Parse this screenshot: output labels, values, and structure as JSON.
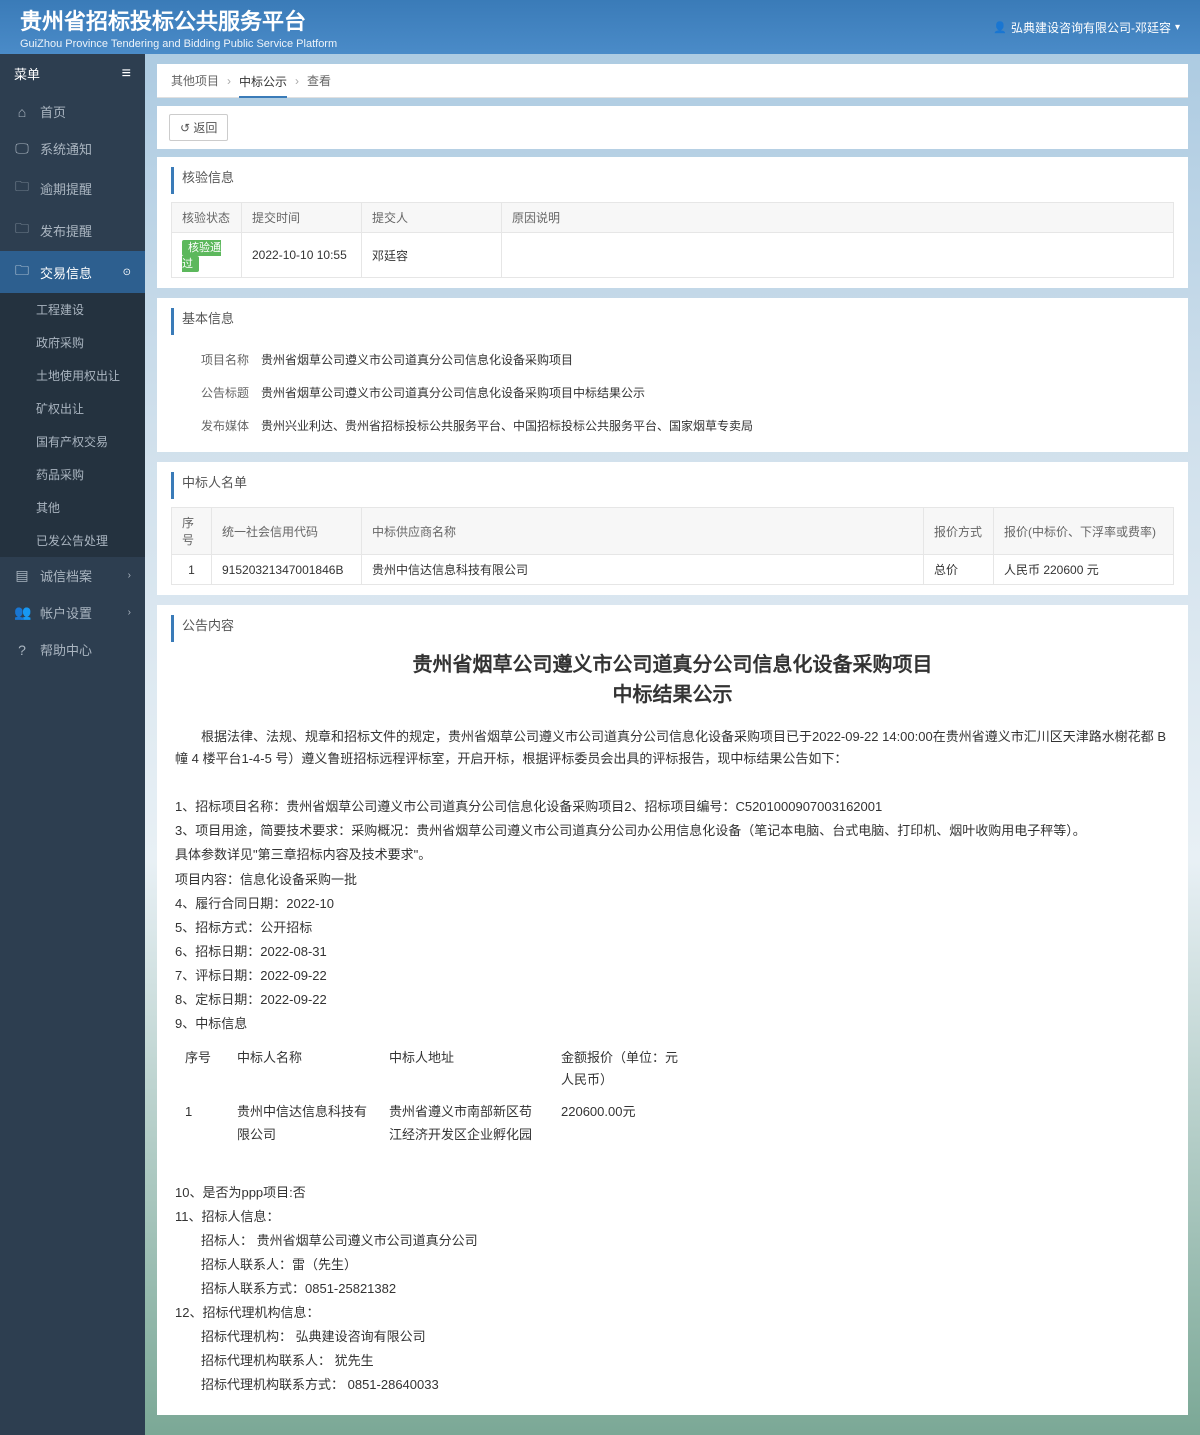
{
  "header": {
    "title": "贵州省招标投标公共服务平台",
    "subtitle": "GuiZhou Province Tendering and Bidding Public Service Platform",
    "user": "弘典建设咨询有限公司-邓廷容"
  },
  "sidebar": {
    "menu_label": "菜单",
    "items": [
      {
        "icon": "⌂",
        "label": "首页"
      },
      {
        "icon": "🖵",
        "label": "系统通知"
      },
      {
        "icon": "🗀",
        "label": "逾期提醒"
      },
      {
        "icon": "🗀",
        "label": "发布提醒"
      },
      {
        "icon": "🗀",
        "label": "交易信息",
        "active": true,
        "expanded": true
      },
      {
        "icon": "▤",
        "label": "诚信档案",
        "chevron": true
      },
      {
        "icon": "👥",
        "label": "帐户设置",
        "chevron": true
      },
      {
        "icon": "?",
        "label": "帮助中心"
      }
    ],
    "sub_items": [
      "工程建设",
      "政府采购",
      "土地使用权出让",
      "矿权出让",
      "国有产权交易",
      "药品采购",
      "其他",
      "已发公告处理"
    ]
  },
  "breadcrumb": {
    "a": "其他项目",
    "b": "中标公示",
    "c": "查看"
  },
  "back_label": "返回",
  "panels": {
    "verify": {
      "title": "核验信息",
      "headers": [
        "核验状态",
        "提交时间",
        "提交人",
        "原因说明"
      ],
      "row": {
        "status": "核验通过",
        "time": "2022-10-10 10:55",
        "person": "邓廷容",
        "reason": ""
      }
    },
    "basic": {
      "title": "基本信息",
      "rows": [
        {
          "label": "项目名称",
          "value": "贵州省烟草公司遵义市公司道真分公司信息化设备采购项目"
        },
        {
          "label": "公告标题",
          "value": "贵州省烟草公司遵义市公司道真分公司信息化设备采购项目中标结果公示"
        },
        {
          "label": "发布媒体",
          "value": "贵州兴业利达、贵州省招标投标公共服务平台、中国招标投标公共服务平台、国家烟草专卖局"
        }
      ]
    },
    "winners": {
      "title": "中标人名单",
      "headers": [
        "序号",
        "统一社会信用代码",
        "中标供应商名称",
        "报价方式",
        "报价(中标价、下浮率或费率)"
      ],
      "row": {
        "no": "1",
        "code": "91520321347001846B",
        "name": "贵州中信达信息科技有限公司",
        "method": "总价",
        "price": "人民币 220600 元"
      }
    },
    "notice": {
      "title": "公告内容",
      "heading1": "贵州省烟草公司遵义市公司道真分公司信息化设备采购项目",
      "heading2": "中标结果公示",
      "intro": "根据法律、法规、规章和招标文件的规定，贵州省烟草公司遵义市公司道真分公司信息化设备采购项目已于2022-09-22 14:00:00在贵州省遵义市汇川区天津路水榭花都 B 幢 4 楼平台1-4-5 号）遵义鲁班招标远程评标室，开启开标，根据评标委员会出具的评标报告，现中标结果公告如下：",
      "lines": [
        "1、招标项目名称：贵州省烟草公司遵义市公司道真分公司信息化设备采购项目2、招标项目编号：C5201000907003162001",
        "3、项目用途，简要技术要求：采购概况：贵州省烟草公司遵义市公司道真分公司办公用信息化设备（笔记本电脑、台式电脑、打印机、烟叶收购用电子秤等）。",
        "具体参数详见\"第三章招标内容及技术要求\"。",
        "项目内容：信息化设备采购一批",
        "4、履行合同日期：2022-10",
        "5、招标方式：公开招标",
        "6、招标日期：2022-08-31",
        "7、评标日期：2022-09-22",
        "8、定标日期：2022-09-22",
        "9、中标信息"
      ],
      "bid_headers": [
        "序号",
        "中标人名称",
        "中标人地址",
        "金额报价（单位：元人民币）"
      ],
      "bid_row": {
        "no": "1",
        "name": "贵州中信达信息科技有限公司",
        "addr": "贵州省遵义市南部新区苟江经济开发区企业孵化园",
        "amount": "220600.00元"
      },
      "tail": [
        "10、是否为ppp项目:否",
        "11、招标人信息：",
        "　　招标人： 贵州省烟草公司遵义市公司道真分公司",
        "　　招标人联系人：雷（先生）",
        "　　招标人联系方式：0851-25821382",
        "12、招标代理机构信息：",
        "　　招标代理机构： 弘典建设咨询有限公司",
        "　　招标代理机构联系人： 犹先生",
        "　　招标代理机构联系方式： 0851-28640033"
      ]
    }
  }
}
